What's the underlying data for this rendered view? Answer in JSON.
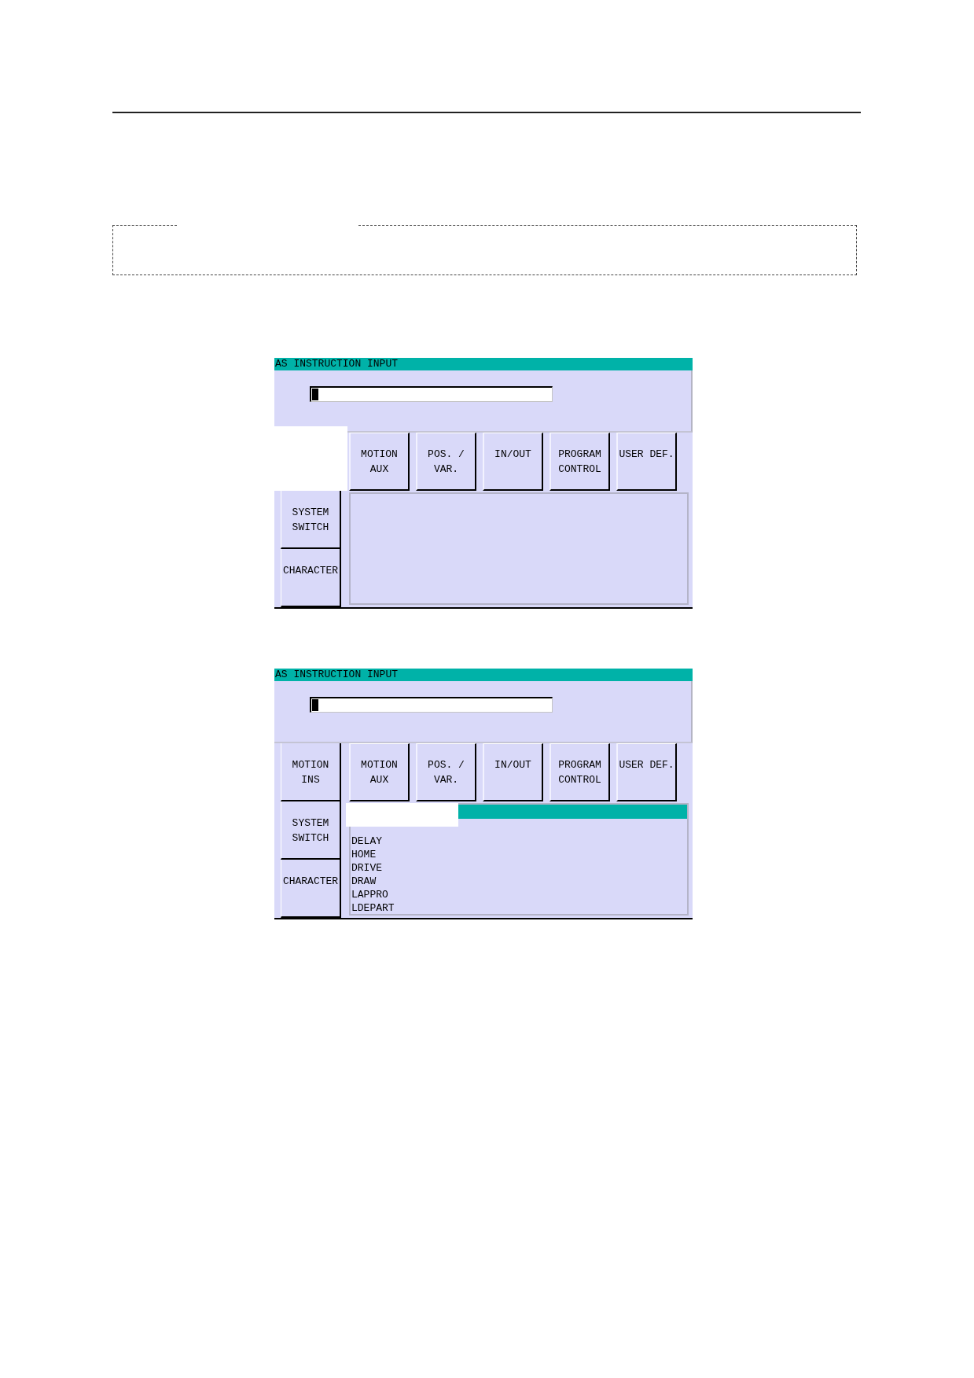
{
  "panels": [
    {
      "title": "AS INSTRUCTION INPUT",
      "input": {
        "cursor": true
      },
      "side_buttons": [
        {
          "kind": "covered"
        },
        {
          "kind": "button",
          "label": "SYSTEM\nSWITCH"
        },
        {
          "kind": "button",
          "label": "CHARACTER"
        }
      ],
      "category_buttons": [
        {
          "label": "MOTION\nAUX"
        },
        {
          "label": "POS. /\nVAR."
        },
        {
          "label": "IN/OUT"
        },
        {
          "label": "PROGRAM\nCONTROL"
        },
        {
          "label": "USER DEF."
        }
      ]
    },
    {
      "title": "AS INSTRUCTION INPUT",
      "input": {
        "cursor": true
      },
      "side_buttons": [
        {
          "kind": "button",
          "label": "MOTION\nINS"
        },
        {
          "kind": "button",
          "label": "SYSTEM\nSWITCH"
        },
        {
          "kind": "button",
          "label": "CHARACTER"
        }
      ],
      "category_buttons": [
        {
          "label": "MOTION\nAUX"
        },
        {
          "label": "POS. /\nVAR."
        },
        {
          "label": "IN/OUT"
        },
        {
          "label": "PROGRAM\nCONTROL"
        },
        {
          "label": "USER DEF."
        }
      ],
      "list": {
        "header_bar": true,
        "covered": true,
        "items": [
          "DELAY",
          "HOME",
          "DRIVE",
          "DRAW",
          "LAPPRO",
          "LDEPART"
        ]
      }
    }
  ]
}
